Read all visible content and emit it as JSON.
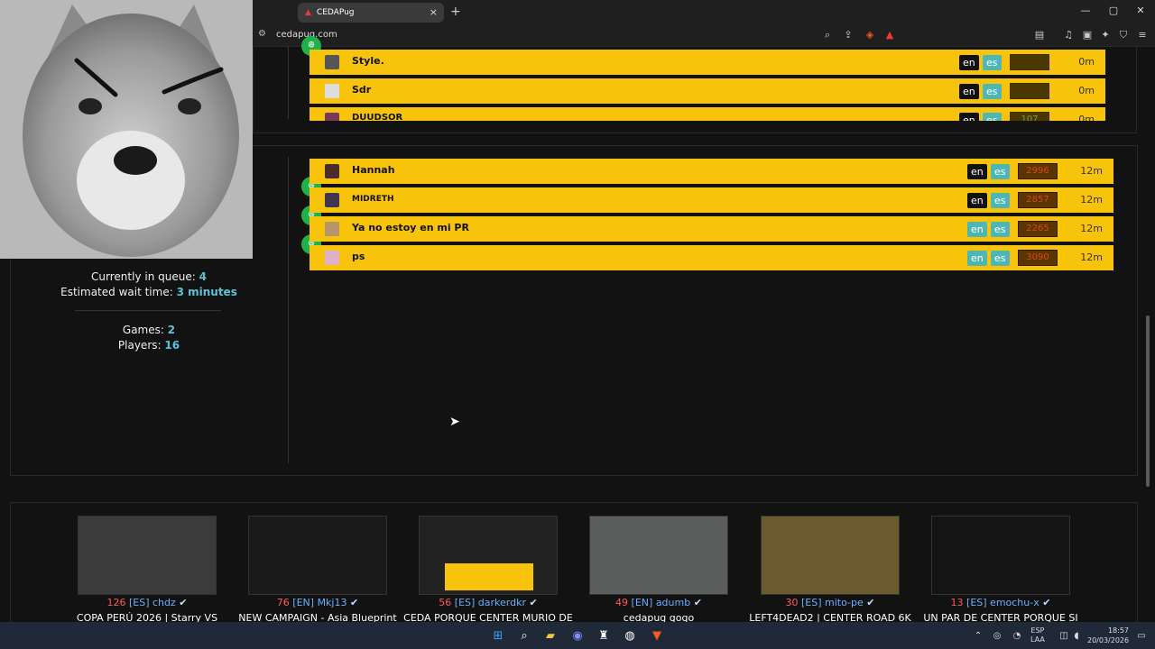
{
  "browser": {
    "tab_title": "CEDAPug",
    "url": "cedapug.com",
    "new_tab": "+",
    "tab_close": "×",
    "window_controls": [
      "—",
      "▢",
      "✕"
    ]
  },
  "queue_game1": {
    "rows": [
      {
        "name": "Style.",
        "lang1": "en",
        "lang2": "es",
        "elo": "",
        "time": "0m"
      },
      {
        "name": "Sdr",
        "lang1": "en",
        "lang2": "es",
        "elo": "",
        "time": "0m"
      },
      {
        "name": "DUUDSOR",
        "lang1": "en",
        "lang2": "es",
        "elo": "107",
        "time": "0m"
      }
    ]
  },
  "queue_game2": {
    "rows": [
      {
        "name": "Hannah",
        "lang1": "en",
        "lang2": "es",
        "elo": "2996",
        "time": "12m"
      },
      {
        "name": "MIDRETH",
        "lang1": "en",
        "lang2": "es",
        "elo": "2857",
        "time": "12m"
      },
      {
        "name": "Ya no estoy en mi PR",
        "lang1": "en",
        "lang2": "es",
        "elo": "2265",
        "time": "12m"
      },
      {
        "name": "ps",
        "lang1": "en",
        "lang2": "es",
        "elo": "3090",
        "time": "12m"
      }
    ]
  },
  "stats": {
    "queue_label": "Currently in queue:",
    "queue_value": "4",
    "wait_label": "Estimated wait time:",
    "wait_value": "3 minutes",
    "games_label": "Games:",
    "games_value": "2",
    "players_label": "Players:",
    "players_value": "16"
  },
  "streams": [
    {
      "viewers": "126",
      "lang": "[ES]",
      "name": "chdz",
      "title": "COPA PERÚ 2026 | Starry VS"
    },
    {
      "viewers": "76",
      "lang": "[EN]",
      "name": "Mkj13",
      "title": "NEW CAMPAIGN - Asia Blueprint"
    },
    {
      "viewers": "56",
      "lang": "[ES]",
      "name": "darkerdkr",
      "title": "CEDA PORQUE CENTER MURIO DE"
    },
    {
      "viewers": "49",
      "lang": "[EN]",
      "name": "adumb",
      "title": "cedapug gogo"
    },
    {
      "viewers": "30",
      "lang": "[ES]",
      "name": "mito-pe",
      "title": "LEFT4DEAD2 | CENTER ROAD 6K"
    },
    {
      "viewers": "13",
      "lang": "[ES]",
      "name": "emochu-x",
      "title": "UN PAR DE CENTER PORQUE SI"
    }
  ],
  "taskbar": {
    "lang": "ESP",
    "layout": "LAA",
    "time": "18:57",
    "date": "20/03/2026"
  }
}
